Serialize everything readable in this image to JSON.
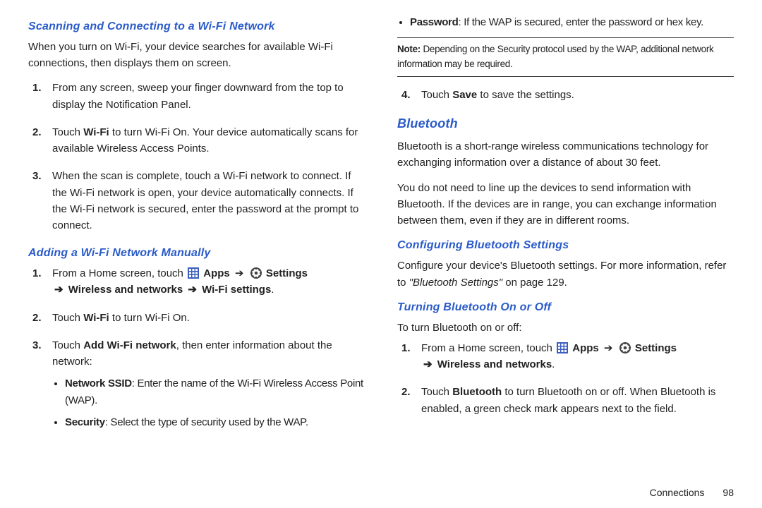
{
  "left": {
    "h_scan": "Scanning and Connecting to a Wi-Fi Network",
    "scan_intro": "When you turn on Wi-Fi, your device searches for available Wi-Fi connections, then displays them on screen.",
    "s1": "From any screen, sweep your finger downward from the top to display the Notification Panel.",
    "s2_a": "Touch ",
    "s2_b": "Wi-Fi",
    "s2_c": " to turn Wi-Fi On. Your device automatically scans for available Wireless Access Points.",
    "s3": "When the scan is complete, touch a Wi-Fi network to connect. If the Wi-Fi network is open, your device automatically connects. If the Wi-Fi network is secured, enter the password at the prompt to connect.",
    "h_add": "Adding a Wi-Fi Network Manually",
    "a1_a": "From a Home screen, touch ",
    "a1_apps": "Apps",
    "a1_arrow": "➔",
    "a1_settings": "Settings",
    "a1_d": "Wireless and networks",
    "a1_e": "Wi-Fi settings",
    "a1_period": ".",
    "a2_a": "Touch ",
    "a2_b": "Wi-Fi",
    "a2_c": " to turn Wi-Fi On.",
    "a3_a": "Touch ",
    "a3_b": "Add Wi-Fi network",
    "a3_c": ", then enter information about the network:",
    "b1_label": "Network SSID",
    "b1_text": ": Enter the name of the Wi-Fi Wireless Access Point (WAP).",
    "b2_label": "Security",
    "b2_text": ": Select the type of security used by the WAP."
  },
  "right": {
    "pw_label": "Password",
    "pw_text": ": If the WAP is secured, enter the password or hex key.",
    "note_label": "Note:",
    "note_text": " Depending on the Security protocol used by the WAP, additional network information may be required.",
    "c4_a": "Touch ",
    "c4_b": "Save",
    "c4_c": " to save the settings.",
    "h_bt": "Bluetooth",
    "bt_p1": "Bluetooth is a short-range wireless communications technology for exchanging information over a distance of about 30 feet.",
    "bt_p2": "You do not need to line up the devices to send information with Bluetooth. If the devices are in range, you can exchange information between them, even if they are in different rooms.",
    "h_conf": "Configuring Bluetooth Settings",
    "conf_a": "Configure your device's Bluetooth settings. For more information, refer to ",
    "conf_ref": "\"Bluetooth Settings\" ",
    "conf_b": " on page 129.",
    "h_onoff": "Turning Bluetooth On or Off",
    "onoff_intro": "To turn Bluetooth on or off:",
    "o1_a": "From a Home screen, touch ",
    "o1_apps": "Apps",
    "o1_arrow": "➔",
    "o1_settings": "Settings",
    "o1_d": "Wireless and networks",
    "o1_period": ".",
    "o2_a": "Touch ",
    "o2_b": "Bluetooth",
    "o2_c": " to turn Bluetooth on or off. When Bluetooth is enabled, a green check mark appears next to the field."
  },
  "footer": {
    "section": "Connections",
    "page": "98"
  },
  "glyphs": {
    "arrow": "➔"
  }
}
